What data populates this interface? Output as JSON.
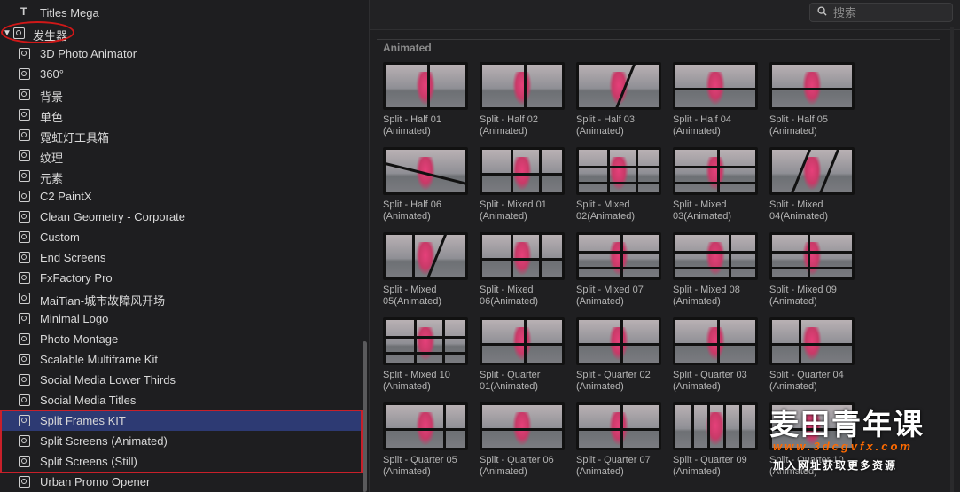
{
  "sidebar": {
    "titles_item": "Titles Mega",
    "generator_label": "发生器",
    "items": [
      "3D Photo Animator",
      "360°",
      "背景",
      "单色",
      "霓虹灯工具箱",
      "纹理",
      "元素",
      "C2 PaintX",
      "Clean Geometry - Corporate",
      "Custom",
      "End Screens",
      "FxFactory Pro",
      "MaiTian-城市故障风开场",
      "Minimal Logo",
      "Photo Montage",
      "Scalable Multiframe Kit",
      "Social Media Lower Thirds",
      "Social Media Titles",
      "Split Frames KIT",
      "Split Screens (Animated)",
      "Split Screens (Still)",
      "Urban Promo Opener"
    ],
    "selected_index": 18
  },
  "search": {
    "placeholder": "搜索"
  },
  "browser": {
    "section_title": "Animated",
    "tiles": [
      "Split - Half 01\n(Animated)",
      "Split - Half 02\n(Animated)",
      "Split - Half 03\n(Animated)",
      "Split - Half 04\n(Animated)",
      "Split - Half 05\n(Animated)",
      "Split - Half 06\n(Animated)",
      "Split - Mixed 01\n(Animated)",
      "Split - Mixed\n02(Animated)",
      "Split - Mixed\n03(Animated)",
      "Split - Mixed\n04(Animated)",
      "Split - Mixed\n05(Animated)",
      "Split - Mixed\n06(Animated)",
      "Split - Mixed 07\n(Animated)",
      "Split - Mixed 08\n(Animated)",
      "Split - Mixed 09\n(Animated)",
      "Split - Mixed 10\n(Animated)",
      "Split - Quarter\n01(Animated)",
      "Split - Quarter 02\n(Animated)",
      "Split - Quarter 03\n(Animated)",
      "Split - Quarter 04\n(Animated)",
      "Split - Quarter 05\n(Animated)",
      "Split - Quarter 06\n(Animated)",
      "Split - Quarter 07\n(Animated)",
      "Split - Quarter 09\n(Animated)",
      "Split - Quarter 10\n(Animated)"
    ]
  },
  "watermark": {
    "title": "麦田青年课",
    "url": "www.3dcgvfx.com",
    "subtitle": "加入网址获取更多资源"
  },
  "colors": {
    "selection": "#2d3a73",
    "highlight_border": "#c8202a",
    "background": "#1f1f21"
  }
}
